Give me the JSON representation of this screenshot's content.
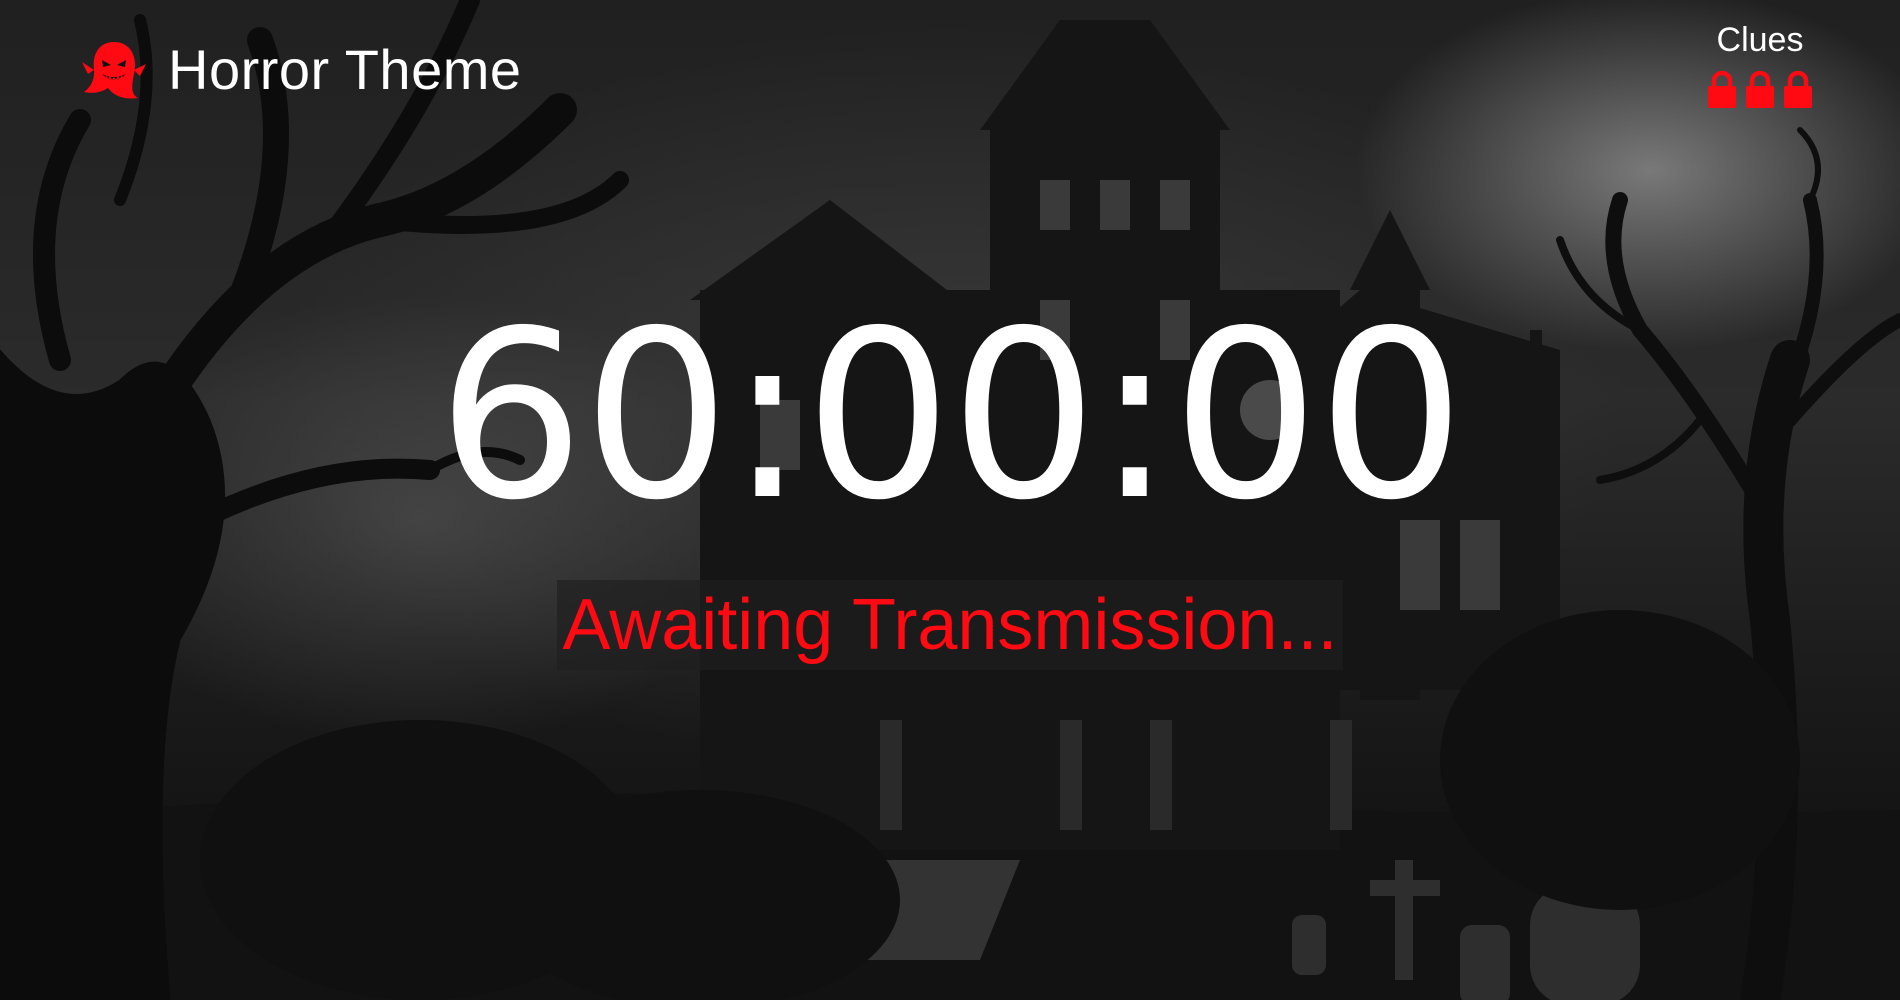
{
  "header": {
    "title": "Horror Theme",
    "icon": "ghost-icon",
    "icon_color": "#ff0a12"
  },
  "clues": {
    "label": "Clues",
    "locks": [
      "lock-icon",
      "lock-icon",
      "lock-icon"
    ],
    "lock_color": "#ff0a12"
  },
  "timer": {
    "value": "60:00:00"
  },
  "status": {
    "message": "Awaiting Transmission...",
    "color": "#ff0a12"
  },
  "background": {
    "scene": "haunted-mansion-night"
  }
}
